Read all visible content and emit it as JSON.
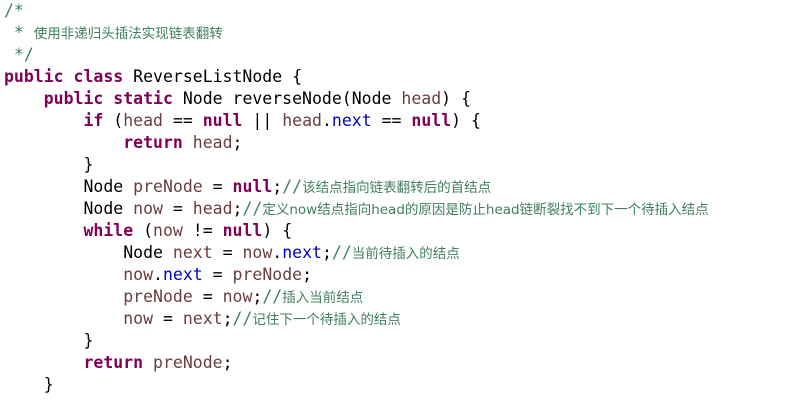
{
  "editor": {
    "lines": [
      {
        "indent": "",
        "tokens": [
          {
            "c": "c",
            "t": "/*"
          }
        ]
      },
      {
        "indent": " ",
        "tokens": [
          {
            "c": "c",
            "t": "* "
          },
          {
            "c": "cz",
            "t": "使用非递归头插法实现链表翻转"
          }
        ]
      },
      {
        "indent": " ",
        "tokens": [
          {
            "c": "c",
            "t": "*/"
          }
        ]
      },
      {
        "indent": "",
        "tokens": [
          {
            "c": "k",
            "t": "public"
          },
          {
            "c": "t",
            "t": " "
          },
          {
            "c": "k",
            "t": "class"
          },
          {
            "c": "t",
            "t": " ReverseListNode {"
          }
        ]
      },
      {
        "indent": "    ",
        "tokens": [
          {
            "c": "k",
            "t": "public"
          },
          {
            "c": "t",
            "t": " "
          },
          {
            "c": "k",
            "t": "static"
          },
          {
            "c": "t",
            "t": " Node reverseNode(Node "
          },
          {
            "c": "v",
            "t": "head"
          },
          {
            "c": "t",
            "t": ") {"
          }
        ]
      },
      {
        "indent": "        ",
        "tokens": [
          {
            "c": "k",
            "t": "if"
          },
          {
            "c": "t",
            "t": " ("
          },
          {
            "c": "v",
            "t": "head"
          },
          {
            "c": "t",
            "t": " == "
          },
          {
            "c": "k",
            "t": "null"
          },
          {
            "c": "t",
            "t": " || "
          },
          {
            "c": "v",
            "t": "head"
          },
          {
            "c": "t",
            "t": "."
          },
          {
            "c": "f",
            "t": "next"
          },
          {
            "c": "t",
            "t": " == "
          },
          {
            "c": "k",
            "t": "null"
          },
          {
            "c": "t",
            "t": ") {"
          }
        ]
      },
      {
        "indent": "            ",
        "tokens": [
          {
            "c": "k",
            "t": "return"
          },
          {
            "c": "t",
            "t": " "
          },
          {
            "c": "v",
            "t": "head"
          },
          {
            "c": "t",
            "t": ";"
          }
        ]
      },
      {
        "indent": "        ",
        "tokens": [
          {
            "c": "t",
            "t": "}"
          }
        ]
      },
      {
        "indent": "        ",
        "tokens": [
          {
            "c": "t",
            "t": "Node "
          },
          {
            "c": "v",
            "t": "preNode"
          },
          {
            "c": "t",
            "t": " = "
          },
          {
            "c": "k",
            "t": "null"
          },
          {
            "c": "t",
            "t": ";"
          },
          {
            "c": "c",
            "t": "//"
          },
          {
            "c": "cz",
            "t": "该结点指向链表翻转后的首结点"
          }
        ]
      },
      {
        "indent": "        ",
        "tokens": [
          {
            "c": "t",
            "t": "Node "
          },
          {
            "c": "v",
            "t": "now"
          },
          {
            "c": "t",
            "t": " = "
          },
          {
            "c": "v",
            "t": "head"
          },
          {
            "c": "t",
            "t": ";"
          },
          {
            "c": "c",
            "t": "//"
          },
          {
            "c": "cz",
            "t": "定义now结点指向head的原因是防止head链断裂找不到下一个待插入结点"
          }
        ]
      },
      {
        "indent": "        ",
        "tokens": [
          {
            "c": "k",
            "t": "while"
          },
          {
            "c": "t",
            "t": " ("
          },
          {
            "c": "v",
            "t": "now"
          },
          {
            "c": "t",
            "t": " != "
          },
          {
            "c": "k",
            "t": "null"
          },
          {
            "c": "t",
            "t": ") {"
          }
        ]
      },
      {
        "indent": "            ",
        "tokens": [
          {
            "c": "t",
            "t": "Node "
          },
          {
            "c": "v",
            "t": "next"
          },
          {
            "c": "t",
            "t": " = "
          },
          {
            "c": "v",
            "t": "now"
          },
          {
            "c": "t",
            "t": "."
          },
          {
            "c": "f",
            "t": "next"
          },
          {
            "c": "t",
            "t": ";"
          },
          {
            "c": "c",
            "t": "//"
          },
          {
            "c": "cz",
            "t": "当前待插入的结点"
          }
        ]
      },
      {
        "indent": "            ",
        "tokens": [
          {
            "c": "v",
            "t": "now"
          },
          {
            "c": "t",
            "t": "."
          },
          {
            "c": "f",
            "t": "next"
          },
          {
            "c": "t",
            "t": " = "
          },
          {
            "c": "v",
            "t": "preNode"
          },
          {
            "c": "t",
            "t": ";"
          }
        ]
      },
      {
        "indent": "            ",
        "tokens": [
          {
            "c": "v",
            "t": "preNode"
          },
          {
            "c": "t",
            "t": " = "
          },
          {
            "c": "v",
            "t": "now"
          },
          {
            "c": "t",
            "t": ";"
          },
          {
            "c": "c",
            "t": "//"
          },
          {
            "c": "cz",
            "t": "插入当前结点"
          }
        ]
      },
      {
        "indent": "            ",
        "tokens": [
          {
            "c": "v",
            "t": "now"
          },
          {
            "c": "t",
            "t": " = "
          },
          {
            "c": "v",
            "t": "next"
          },
          {
            "c": "t",
            "t": ";"
          },
          {
            "c": "c",
            "t": "//"
          },
          {
            "c": "cz",
            "t": "记住下一个待插入的结点"
          }
        ]
      },
      {
        "indent": "        ",
        "tokens": [
          {
            "c": "t",
            "t": "}"
          }
        ]
      },
      {
        "indent": "        ",
        "tokens": [
          {
            "c": "k",
            "t": "return"
          },
          {
            "c": "t",
            "t": " "
          },
          {
            "c": "v",
            "t": "preNode"
          },
          {
            "c": "t",
            "t": ";"
          }
        ]
      },
      {
        "indent": "    ",
        "tokens": [
          {
            "c": "t",
            "t": "}"
          }
        ]
      }
    ]
  },
  "colors": {
    "keyword": "#7f0055",
    "comment": "#3f7f5f",
    "variable": "#6a3e3e",
    "field": "#0000c0",
    "text": "#000000",
    "background": "#ffffff"
  }
}
